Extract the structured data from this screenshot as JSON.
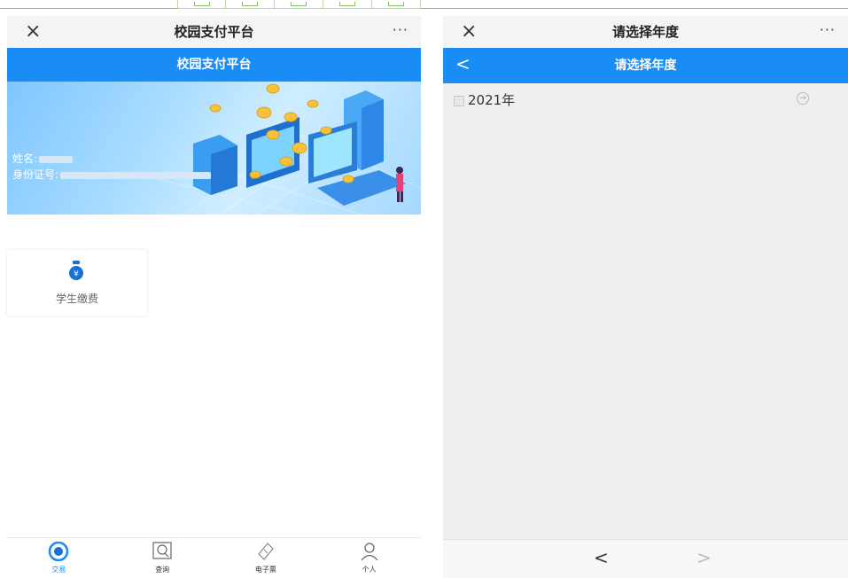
{
  "left": {
    "nav_title": "校园支付平台",
    "nav_close": "×",
    "nav_more": "···",
    "header_title": "校园支付平台",
    "banner": {
      "name_label": "姓名:",
      "id_label": "身份证号:"
    },
    "tile": {
      "label": "学生缴费"
    },
    "tabs": [
      {
        "label": "交易"
      },
      {
        "label": "查询"
      },
      {
        "label": "电子票"
      },
      {
        "label": "个人"
      }
    ]
  },
  "right": {
    "nav_title": "请选择年度",
    "nav_close": "×",
    "nav_more": "···",
    "header_back": "<",
    "header_title": "请选择年度",
    "year_label": "2021年",
    "pager_prev": "<",
    "pager_next": ">"
  },
  "colors": {
    "accent": "#1a8cf6",
    "nav_bg": "#f4f4f4",
    "right_bg": "#efefef"
  }
}
